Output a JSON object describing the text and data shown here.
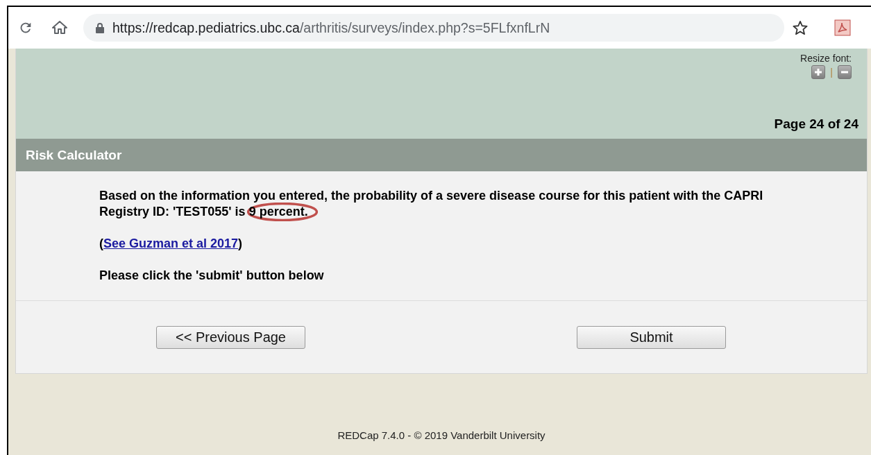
{
  "browser": {
    "url_host": "https://redcap.pediatrics.ubc.ca",
    "url_path": "/arthritis/surveys/index.php?s=5FLfxnfLrN"
  },
  "survey": {
    "resize_label": "Resize font:",
    "resize_separator": "|",
    "page_indicator": "Page 24 of 24",
    "section_title": "Risk Calculator",
    "result_text": "Based on the information you entered, the probability of a severe disease course for this patient with the CAPRI Registry ID: 'TEST055' is 9 percent.",
    "citation_open": "(",
    "citation_link": "See Guzman et al 2017",
    "citation_close": ")",
    "instruction": "Please click the 'submit' button below",
    "buttons": [
      {
        "label": "<< Previous Page"
      },
      {
        "label": "Submit"
      }
    ]
  },
  "footer": "REDCap 7.4.0 - © 2019 Vanderbilt University"
}
